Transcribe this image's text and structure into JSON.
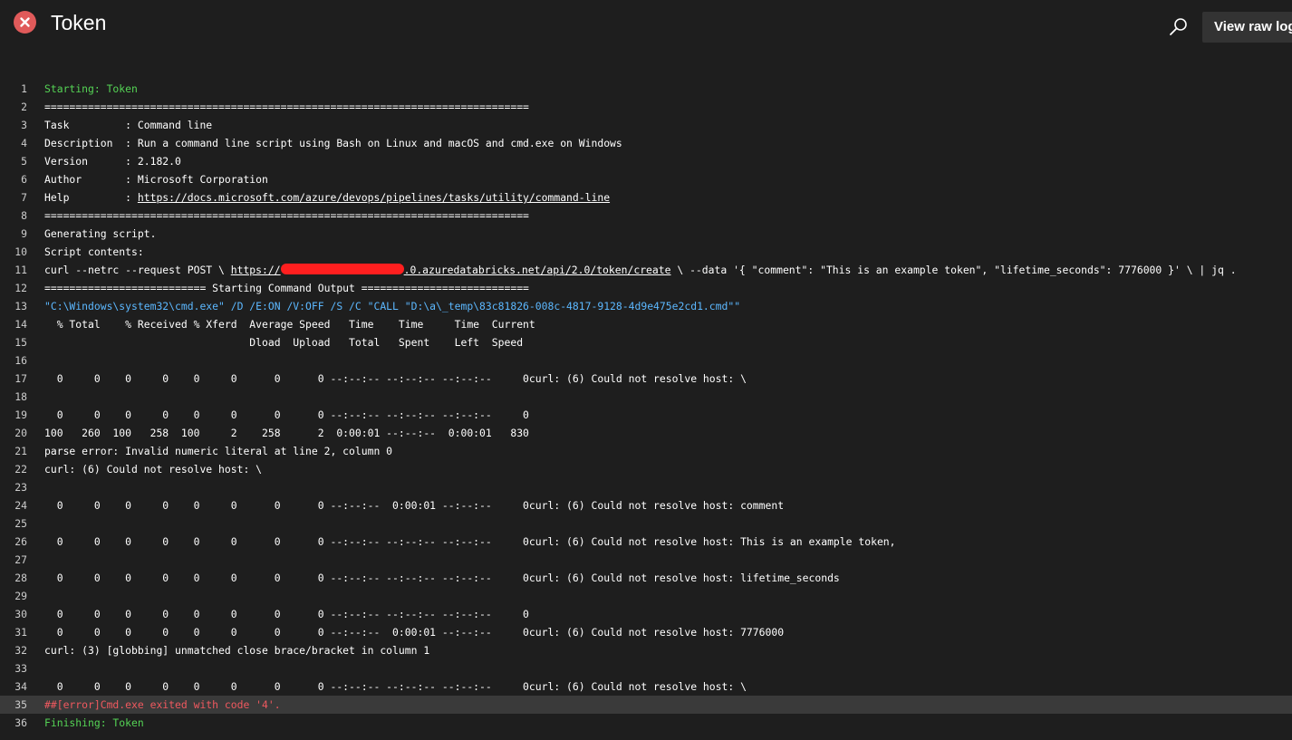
{
  "header": {
    "title": "Token",
    "view_raw_label": "View raw log",
    "status": "failed",
    "status_color": "#e05a5a"
  },
  "colors": {
    "background": "#1e1e1e",
    "section": "#55d455",
    "command": "#5cb8ff",
    "error": "#f0595f",
    "highlight_row": "#3a3a3a"
  },
  "log_lines": [
    {
      "n": "1",
      "parts": [
        {
          "t": "Starting: Token"
        }
      ],
      "style": "green"
    },
    {
      "n": "2",
      "parts": [
        {
          "t": "=============================================================================="
        }
      ]
    },
    {
      "n": "3",
      "parts": [
        {
          "t": "Task         : Command line"
        }
      ]
    },
    {
      "n": "4",
      "parts": [
        {
          "t": "Description  : Run a command line script using Bash on Linux and macOS and cmd.exe on Windows"
        }
      ]
    },
    {
      "n": "5",
      "parts": [
        {
          "t": "Version      : 2.182.0"
        }
      ]
    },
    {
      "n": "6",
      "parts": [
        {
          "t": "Author       : Microsoft Corporation"
        }
      ]
    },
    {
      "n": "7",
      "parts": [
        {
          "t": "Help         : "
        },
        {
          "t": "https://docs.microsoft.com/azure/devops/pipelines/tasks/utility/command-line",
          "link": true
        }
      ]
    },
    {
      "n": "8",
      "parts": [
        {
          "t": "=============================================================================="
        }
      ]
    },
    {
      "n": "9",
      "parts": [
        {
          "t": "Generating script."
        }
      ]
    },
    {
      "n": "10",
      "parts": [
        {
          "t": "Script contents:"
        }
      ]
    },
    {
      "n": "11",
      "parts": [
        {
          "t": "curl --netrc --request POST \\ "
        },
        {
          "t": "https://",
          "link": true
        },
        {
          "redact": true
        },
        {
          "t": ".0.azuredatabricks.net/api/2.0/token/create",
          "link": true
        },
        {
          "t": " \\ --data '{ \"comment\": \"This is an example token\", \"lifetime_seconds\": 7776000 }' \\ | jq ."
        }
      ]
    },
    {
      "n": "12",
      "parts": [
        {
          "t": "========================== Starting Command Output ==========================="
        }
      ]
    },
    {
      "n": "13",
      "parts": [
        {
          "t": "\"C:\\Windows\\system32\\cmd.exe\" /D /E:ON /V:OFF /S /C \"CALL \"D:\\a\\_temp\\83c81826-008c-4817-9128-4d9e475e2cd1.cmd\"\""
        }
      ],
      "style": "blue"
    },
    {
      "n": "14",
      "parts": [
        {
          "t": "  % Total    % Received % Xferd  Average Speed   Time    Time     Time  Current"
        }
      ]
    },
    {
      "n": "15",
      "parts": [
        {
          "t": "                                 Dload  Upload   Total   Spent    Left  Speed"
        }
      ]
    },
    {
      "n": "16",
      "parts": [
        {
          "t": ""
        }
      ]
    },
    {
      "n": "17",
      "parts": [
        {
          "t": "  0     0    0     0    0     0      0      0 --:--:-- --:--:-- --:--:--     0curl: (6) Could not resolve host: \\"
        }
      ]
    },
    {
      "n": "18",
      "parts": [
        {
          "t": ""
        }
      ]
    },
    {
      "n": "19",
      "parts": [
        {
          "t": "  0     0    0     0    0     0      0      0 --:--:-- --:--:-- --:--:--     0"
        }
      ]
    },
    {
      "n": "20",
      "parts": [
        {
          "t": "100   260  100   258  100     2    258      2  0:00:01 --:--:--  0:00:01   830"
        }
      ]
    },
    {
      "n": "21",
      "parts": [
        {
          "t": "parse error: Invalid numeric literal at line 2, column 0"
        }
      ]
    },
    {
      "n": "22",
      "parts": [
        {
          "t": "curl: (6) Could not resolve host: \\"
        }
      ]
    },
    {
      "n": "23",
      "parts": [
        {
          "t": ""
        }
      ]
    },
    {
      "n": "24",
      "parts": [
        {
          "t": "  0     0    0     0    0     0      0      0 --:--:--  0:00:01 --:--:--     0curl: (6) Could not resolve host: comment"
        }
      ]
    },
    {
      "n": "25",
      "parts": [
        {
          "t": ""
        }
      ]
    },
    {
      "n": "26",
      "parts": [
        {
          "t": "  0     0    0     0    0     0      0      0 --:--:-- --:--:-- --:--:--     0curl: (6) Could not resolve host: This is an example token,"
        }
      ]
    },
    {
      "n": "27",
      "parts": [
        {
          "t": ""
        }
      ]
    },
    {
      "n": "28",
      "parts": [
        {
          "t": "  0     0    0     0    0     0      0      0 --:--:-- --:--:-- --:--:--     0curl: (6) Could not resolve host: lifetime_seconds"
        }
      ]
    },
    {
      "n": "29",
      "parts": [
        {
          "t": ""
        }
      ]
    },
    {
      "n": "30",
      "parts": [
        {
          "t": "  0     0    0     0    0     0      0      0 --:--:-- --:--:-- --:--:--     0"
        }
      ]
    },
    {
      "n": "31",
      "parts": [
        {
          "t": "  0     0    0     0    0     0      0      0 --:--:--  0:00:01 --:--:--     0curl: (6) Could not resolve host: 7776000"
        }
      ]
    },
    {
      "n": "32",
      "parts": [
        {
          "t": "curl: (3) [globbing] unmatched close brace/bracket in column 1"
        }
      ]
    },
    {
      "n": "33",
      "parts": [
        {
          "t": ""
        }
      ]
    },
    {
      "n": "34",
      "parts": [
        {
          "t": "  0     0    0     0    0     0      0      0 --:--:-- --:--:-- --:--:--     0curl: (6) Could not resolve host: \\"
        }
      ]
    },
    {
      "n": "35",
      "parts": [
        {
          "t": "##[error]Cmd.exe exited with code '4'."
        }
      ],
      "style": "red",
      "highlight": true
    },
    {
      "n": "36",
      "parts": [
        {
          "t": "Finishing: Token"
        }
      ],
      "style": "green"
    }
  ]
}
